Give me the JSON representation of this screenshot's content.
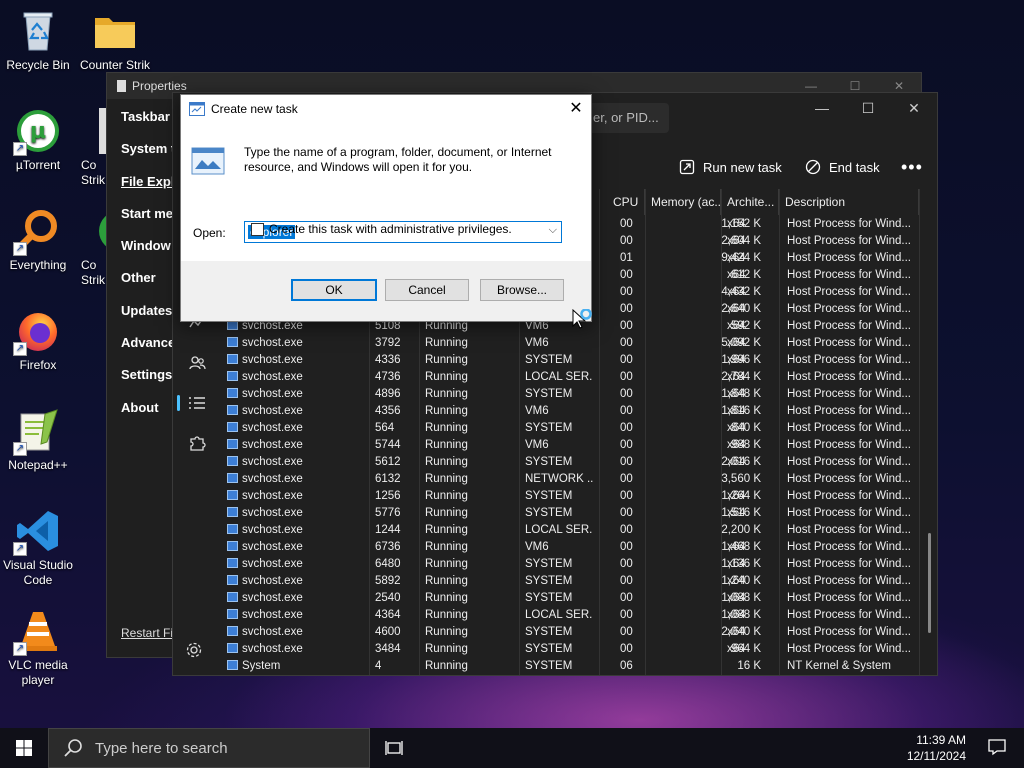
{
  "desktop": {
    "icons": [
      {
        "label": "Recycle Bin",
        "icon": "recycle-bin-icon"
      },
      {
        "label": "Counter Strik",
        "icon": "folder-icon"
      },
      {
        "label": "µTorrent",
        "icon": "utorrent-icon"
      },
      {
        "label": "Everything",
        "icon": "everything-search-icon"
      },
      {
        "label": "Firefox",
        "icon": "firefox-icon"
      },
      {
        "label": "Notepad++",
        "icon": "notepadpp-icon"
      },
      {
        "label": "Visual Studio Code",
        "icon": "vscode-icon"
      },
      {
        "label": "VLC media player",
        "icon": "vlc-icon"
      }
    ],
    "partial_labels": [
      "Co Strik",
      "Co Strik"
    ]
  },
  "properties_window": {
    "title": "Properties",
    "nav": [
      "Taskbar",
      "System t",
      "File Expl",
      "Start me",
      "Window",
      "Other",
      "Updates",
      "Advance",
      "Settings",
      "About"
    ],
    "restart": "Restart Fil"
  },
  "task_manager": {
    "search_placeholder": "er, or PID...",
    "run_new_task": "Run new task",
    "end_task": "End task",
    "columns": {
      "cpu": "CPU",
      "memory": "Memory (ac...",
      "arch": "Archite...",
      "description": "Description"
    },
    "rows_top": [
      {
        "cpu": "00",
        "memory": "1,152 K",
        "arch": "x64",
        "desc": "Host Process for Wind..."
      },
      {
        "cpu": "00",
        "memory": "2,604 K",
        "arch": "x64",
        "desc": "Host Process for Wind..."
      },
      {
        "cpu": "01",
        "memory": "9,424 K",
        "arch": "x64",
        "desc": "Host Process for Wind..."
      },
      {
        "cpu": "00",
        "memory": "612 K",
        "arch": "x64",
        "desc": "Host Process for Wind..."
      },
      {
        "cpu": "00",
        "memory": "4,432 K",
        "arch": "x64",
        "desc": "Host Process for Wind..."
      },
      {
        "cpu": "00",
        "memory": "2,640 K",
        "arch": "x64",
        "desc": "Host Process for Wind..."
      }
    ],
    "rows": [
      {
        "name": "svchost.exe",
        "pid": "5108",
        "status": "Running",
        "user": "VM6",
        "cpu": "00",
        "memory": "592 K",
        "arch": "x64",
        "desc": "Host Process for Wind..."
      },
      {
        "name": "svchost.exe",
        "pid": "3792",
        "status": "Running",
        "user": "VM6",
        "cpu": "00",
        "memory": "5,092 K",
        "arch": "x64",
        "desc": "Host Process for Wind..."
      },
      {
        "name": "svchost.exe",
        "pid": "4336",
        "status": "Running",
        "user": "SYSTEM",
        "cpu": "00",
        "memory": "1,996 K",
        "arch": "x64",
        "desc": "Host Process for Wind..."
      },
      {
        "name": "svchost.exe",
        "pid": "4736",
        "status": "Running",
        "user": "LOCAL SER...",
        "cpu": "00",
        "memory": "2,784 K",
        "arch": "x64",
        "desc": "Host Process for Wind..."
      },
      {
        "name": "svchost.exe",
        "pid": "4896",
        "status": "Running",
        "user": "SYSTEM",
        "cpu": "00",
        "memory": "1,848 K",
        "arch": "x64",
        "desc": "Host Process for Wind..."
      },
      {
        "name": "svchost.exe",
        "pid": "4356",
        "status": "Running",
        "user": "VM6",
        "cpu": "00",
        "memory": "1,816 K",
        "arch": "x64",
        "desc": "Host Process for Wind..."
      },
      {
        "name": "svchost.exe",
        "pid": "564",
        "status": "Running",
        "user": "SYSTEM",
        "cpu": "00",
        "memory": "840 K",
        "arch": "x64",
        "desc": "Host Process for Wind..."
      },
      {
        "name": "svchost.exe",
        "pid": "5744",
        "status": "Running",
        "user": "VM6",
        "cpu": "00",
        "memory": "988 K",
        "arch": "x64",
        "desc": "Host Process for Wind..."
      },
      {
        "name": "svchost.exe",
        "pid": "5612",
        "status": "Running",
        "user": "SYSTEM",
        "cpu": "00",
        "memory": "2,016 K",
        "arch": "x64",
        "desc": "Host Process for Wind..."
      },
      {
        "name": "svchost.exe",
        "pid": "6132",
        "status": "Running",
        "user": "NETWORK ...",
        "cpu": "00",
        "memory": "3,560 K",
        "arch": "",
        "desc": "Host Process for Wind..."
      },
      {
        "name": "svchost.exe",
        "pid": "1256",
        "status": "Running",
        "user": "SYSTEM",
        "cpu": "00",
        "memory": "1,264 K",
        "arch": "x64",
        "desc": "Host Process for Wind..."
      },
      {
        "name": "svchost.exe",
        "pid": "5776",
        "status": "Running",
        "user": "SYSTEM",
        "cpu": "00",
        "memory": "1,516 K",
        "arch": "x64",
        "desc": "Host Process for Wind..."
      },
      {
        "name": "svchost.exe",
        "pid": "1244",
        "status": "Running",
        "user": "LOCAL SER...",
        "cpu": "00",
        "memory": "2,200 K",
        "arch": "",
        "desc": "Host Process for Wind..."
      },
      {
        "name": "svchost.exe",
        "pid": "6736",
        "status": "Running",
        "user": "VM6",
        "cpu": "00",
        "memory": "1,468 K",
        "arch": "x64",
        "desc": "Host Process for Wind..."
      },
      {
        "name": "svchost.exe",
        "pid": "6480",
        "status": "Running",
        "user": "SYSTEM",
        "cpu": "00",
        "memory": "1,136 K",
        "arch": "x64",
        "desc": "Host Process for Wind..."
      },
      {
        "name": "svchost.exe",
        "pid": "5892",
        "status": "Running",
        "user": "SYSTEM",
        "cpu": "00",
        "memory": "1,240 K",
        "arch": "x64",
        "desc": "Host Process for Wind..."
      },
      {
        "name": "svchost.exe",
        "pid": "2540",
        "status": "Running",
        "user": "SYSTEM",
        "cpu": "00",
        "memory": "1,088 K",
        "arch": "x64",
        "desc": "Host Process for Wind..."
      },
      {
        "name": "svchost.exe",
        "pid": "4364",
        "status": "Running",
        "user": "LOCAL SER...",
        "cpu": "00",
        "memory": "1,088 K",
        "arch": "x64",
        "desc": "Host Process for Wind..."
      },
      {
        "name": "svchost.exe",
        "pid": "4600",
        "status": "Running",
        "user": "SYSTEM",
        "cpu": "00",
        "memory": "2,040 K",
        "arch": "x64",
        "desc": "Host Process for Wind..."
      },
      {
        "name": "svchost.exe",
        "pid": "3484",
        "status": "Running",
        "user": "SYSTEM",
        "cpu": "00",
        "memory": "964 K",
        "arch": "x64",
        "desc": "Host Process for Wind..."
      },
      {
        "name": "System",
        "pid": "4",
        "status": "Running",
        "user": "SYSTEM",
        "cpu": "06",
        "memory": "16 K",
        "arch": "",
        "desc": "NT Kernel & System"
      }
    ]
  },
  "dialog": {
    "title": "Create new task",
    "message": "Type the name of a program, folder, document, or Internet resource, and Windows will open it for you.",
    "open_label": "Open:",
    "open_value": "explorer",
    "admin_checkbox": "Create this task with administrative privileges.",
    "ok": "OK",
    "cancel": "Cancel",
    "browse": "Browse..."
  },
  "taskbar": {
    "search_placeholder": "Type here to search",
    "time": "11:39 AM",
    "date": "12/11/2024"
  }
}
